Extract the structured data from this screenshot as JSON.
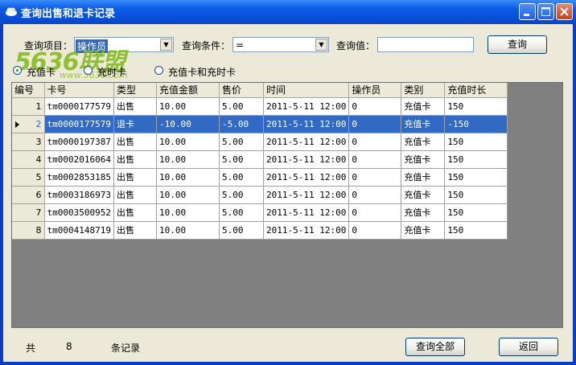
{
  "window": {
    "title": "查询出售和退卡记录"
  },
  "watermark": {
    "text": "5636联盟",
    "sub": "www.5636.com"
  },
  "filters": {
    "field_label": "查询项目：",
    "field_value": "操作员",
    "condition_label": "查询条件：",
    "condition_value": "=",
    "value_label": "查询值：",
    "value_input": "",
    "query_button": "查询"
  },
  "radios": [
    {
      "label": "充值卡",
      "checked": true
    },
    {
      "label": "充时卡",
      "checked": false
    },
    {
      "label": "充值卡和充时卡",
      "checked": false
    }
  ],
  "table": {
    "columns": [
      "编号",
      "卡号",
      "类型",
      "充值金额",
      "售价",
      "时间",
      "操作员",
      "类别",
      "充值时长"
    ],
    "rows": [
      [
        "1",
        "tm0000177579",
        "出售",
        "10.00",
        "5.00",
        "2011-5-11 12:00",
        "0",
        "充值卡",
        "150"
      ],
      [
        "2",
        "tm0000177579",
        "退卡",
        "-10.00",
        "-5.00",
        "2011-5-11 12:00",
        "0",
        "充值卡",
        "-150"
      ],
      [
        "3",
        "tm0000197387",
        "出售",
        "10.00",
        "5.00",
        "2011-5-11 12:00",
        "0",
        "充值卡",
        "150"
      ],
      [
        "4",
        "tm0002016064",
        "出售",
        "10.00",
        "5.00",
        "2011-5-11 12:00",
        "0",
        "充值卡",
        "150"
      ],
      [
        "5",
        "tm0002853185",
        "出售",
        "10.00",
        "5.00",
        "2011-5-11 12:00",
        "0",
        "充值卡",
        "150"
      ],
      [
        "6",
        "tm0003186973",
        "出售",
        "10.00",
        "5.00",
        "2011-5-11 12:00",
        "0",
        "充值卡",
        "150"
      ],
      [
        "7",
        "tm0003500952",
        "出售",
        "10.00",
        "5.00",
        "2011-5-11 12:00",
        "0",
        "充值卡",
        "150"
      ],
      [
        "8",
        "tm0004148719",
        "出售",
        "10.00",
        "5.00",
        "2011-5-11 12:00",
        "0",
        "充值卡",
        "150"
      ]
    ],
    "selected_row": 1
  },
  "footer": {
    "prefix": "共",
    "count": "8",
    "suffix": "条记录",
    "query_all_button": "查询全部",
    "back_button": "返回"
  }
}
